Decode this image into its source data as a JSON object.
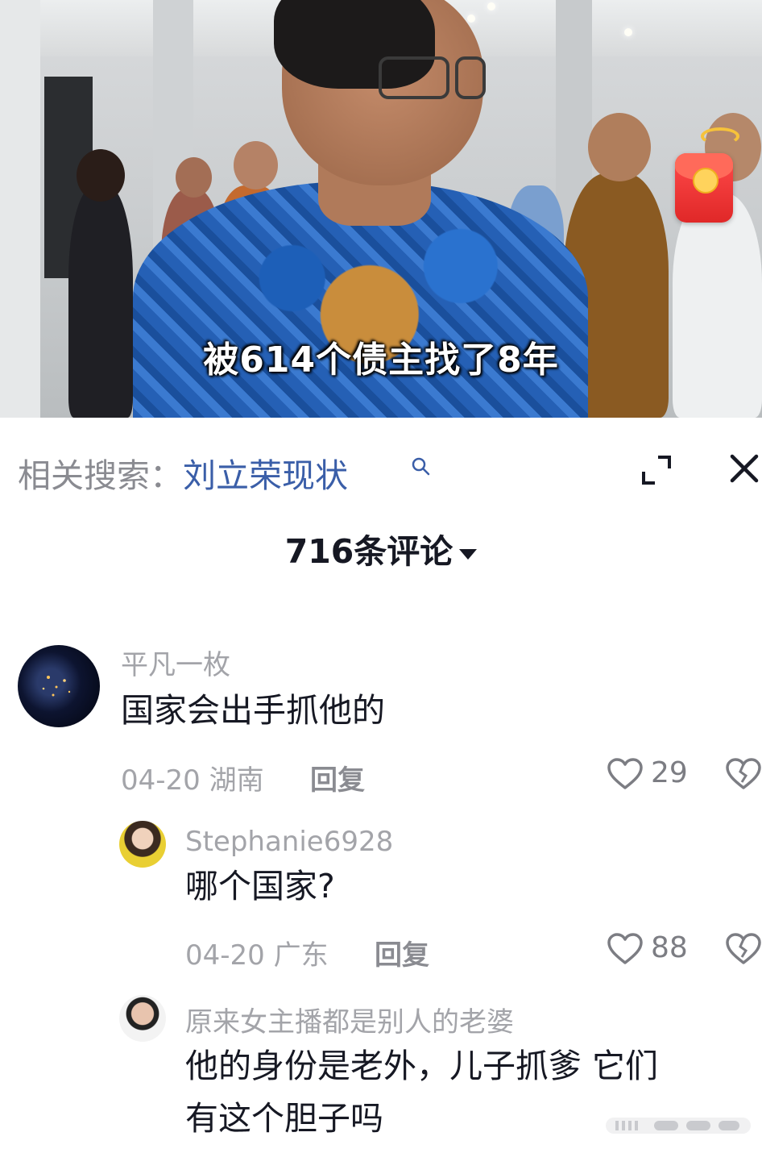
{
  "video": {
    "caption": "被614个债主找了8年",
    "red_packet_icon": "red-packet-icon"
  },
  "panel": {
    "related_prefix": "相关搜索：",
    "related_keyword": "刘立荣现状",
    "comment_count": "716条评论",
    "icons": {
      "search": "search-icon",
      "expand": "expand-icon",
      "close": "close-icon"
    }
  },
  "comments": [
    {
      "user": "平凡一枚",
      "text": "国家会出手抓他的",
      "date": "04-20",
      "location": "湖南",
      "reply": "回复",
      "likes": "29"
    },
    {
      "user": "Stephanie6928",
      "text": "哪个国家?",
      "date": "04-20",
      "location": "广东",
      "reply": "回复",
      "likes": "88"
    },
    {
      "user": "原来女主播都是别人的老婆",
      "text_line1": "他的身份是老外，儿子抓爹 它们",
      "text_line2": "有这个胆子吗"
    }
  ],
  "colors": {
    "accent_keyword": "#3a5ea8",
    "primary_text": "#161823",
    "secondary_text": "#a3a4a9"
  }
}
